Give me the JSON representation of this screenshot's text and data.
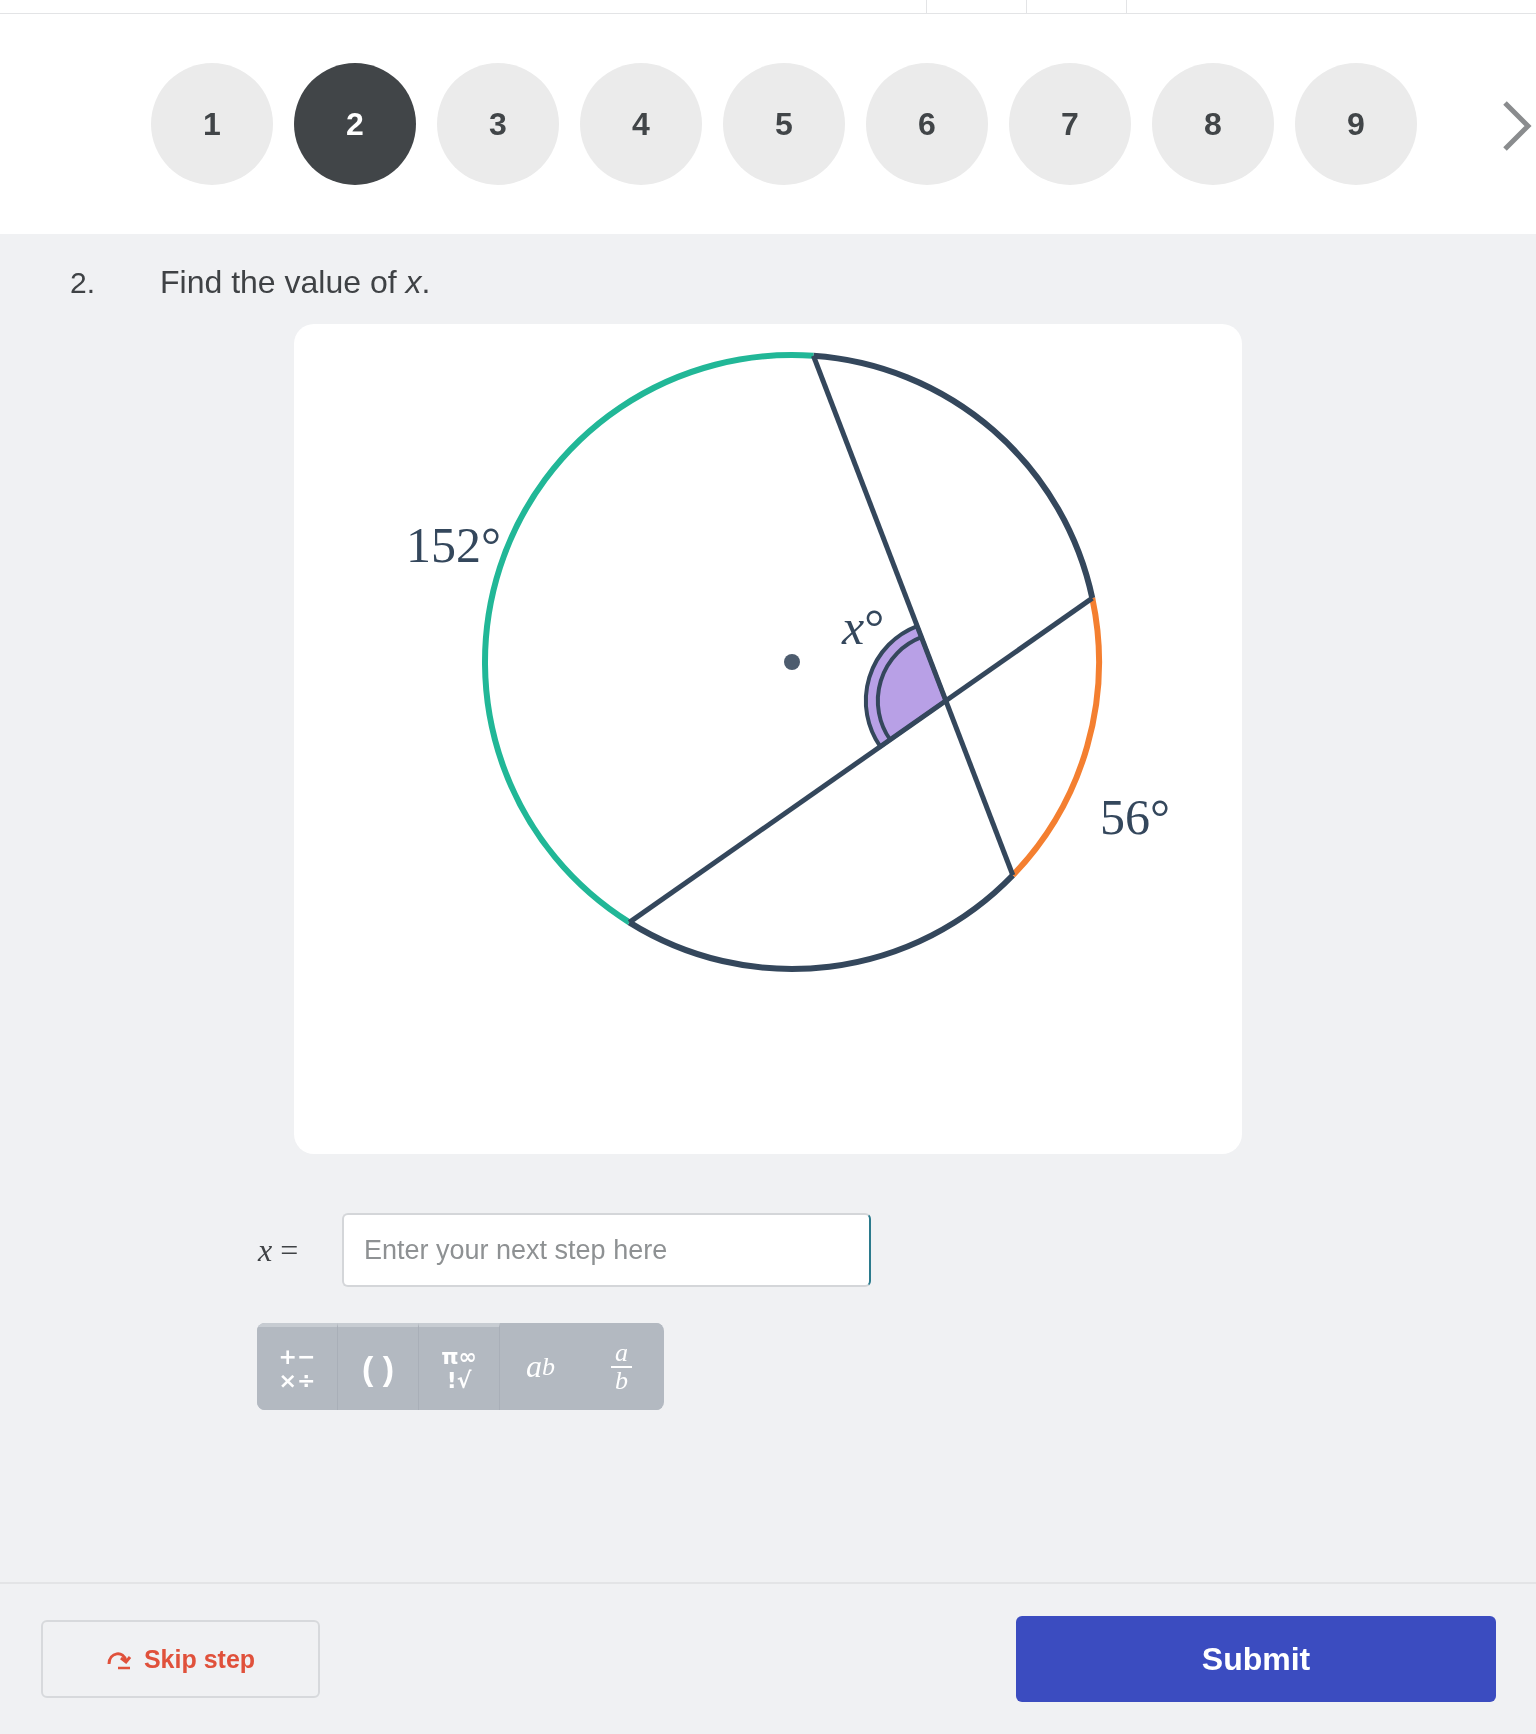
{
  "steps": [
    {
      "label": "1",
      "selected": false
    },
    {
      "label": "2",
      "selected": true
    },
    {
      "label": "3",
      "selected": false
    },
    {
      "label": "4",
      "selected": false
    },
    {
      "label": "5",
      "selected": false
    },
    {
      "label": "6",
      "selected": false
    },
    {
      "label": "7",
      "selected": false
    },
    {
      "label": "8",
      "selected": false
    },
    {
      "label": "9",
      "selected": false
    }
  ],
  "question": {
    "number": "2.",
    "text": "Find the value of *x*."
  },
  "diagram": {
    "arcs": [
      {
        "label": "152°",
        "color": "#21b797"
      },
      {
        "label": "56°",
        "color": "#f47f30"
      }
    ],
    "angle_label": "*x*°"
  },
  "answer": {
    "label": "*x* =",
    "placeholder": "Enter your next step here"
  },
  "math_toolbar": [
    {
      "kind": "pair",
      "lines": [
        "+−",
        "×÷"
      ]
    },
    {
      "kind": "single",
      "text": "( )"
    },
    {
      "kind": "pair",
      "lines": [
        "π∞",
        "!√"
      ]
    },
    {
      "kind": "power",
      "base": "a",
      "exponent": "b"
    },
    {
      "kind": "fraction",
      "numerator": "a",
      "denominator": "b"
    }
  ],
  "footer": {
    "skip": "Skip step",
    "submit": "Submit"
  }
}
